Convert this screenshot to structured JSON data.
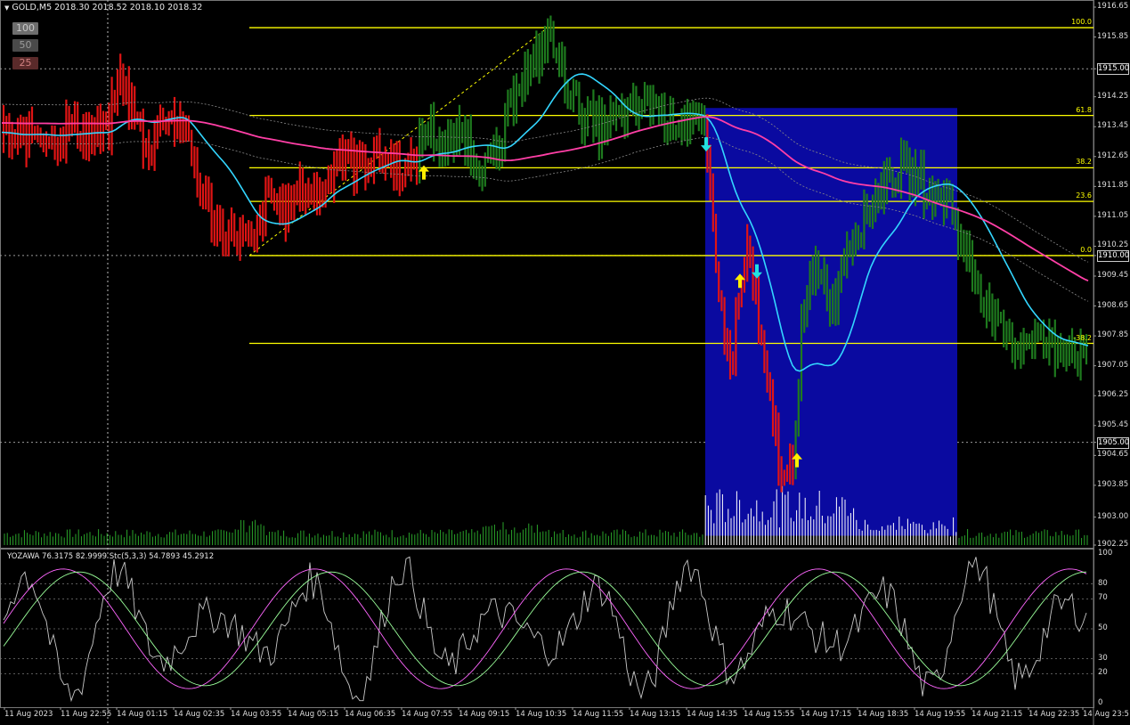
{
  "header": {
    "symbol_info": "GOLD,M5  2018.30 2018.52 2018.10 2018.32",
    "collapse_icon": "triangle-down-icon"
  },
  "level_buttons": [
    "100",
    "50",
    "25"
  ],
  "price_axis": {
    "ticks": [
      "1916.65",
      "1915.85",
      "1915.00",
      "1914.25",
      "1913.45",
      "1912.65",
      "1911.85",
      "1911.05",
      "1910.25",
      "1910.00",
      "1909.45",
      "1908.65",
      "1907.85",
      "1907.05",
      "1906.25",
      "1905.45",
      "1905.00",
      "1904.65",
      "1903.85",
      "1903.00",
      "1902.25"
    ],
    "highlighted": [
      "1915.00",
      "1910.00",
      "1905.00"
    ]
  },
  "fibo_labels": [
    "100.0",
    "61.8",
    "38.2",
    "23.6",
    "0.0",
    "-38.2"
  ],
  "time_axis": [
    "11 Aug 2023",
    "11 Aug 22:55",
    "14 Aug 01:15",
    "14 Aug 02:35",
    "14 Aug 03:55",
    "14 Aug 05:15",
    "14 Aug 06:35",
    "14 Aug 07:55",
    "14 Aug 09:15",
    "14 Aug 10:35",
    "14 Aug 11:55",
    "14 Aug 13:15",
    "14 Aug 14:35",
    "14 Aug 15:55",
    "14 Aug 17:15",
    "14 Aug 18:35",
    "14 Aug 19:55",
    "14 Aug 21:15",
    "14 Aug 22:35",
    "14 Aug 23:5"
  ],
  "oscillator": {
    "header": "YOZAWA 76.3175 82.9999  Stc(5,3,3) 54.7893 45.2912",
    "ticks": [
      "100",
      "80",
      "70",
      "50",
      "30",
      "20",
      "0"
    ]
  },
  "colors": {
    "background": "#000000",
    "bull_bar": "#1e7a1e",
    "bear_bar": "#e01414",
    "fibo": "#ffff00",
    "ma_fast": "#33d6ff",
    "ma_slow": "#ff3fa6",
    "box": "#0a0aa0",
    "osc_main": "#c8c8c8",
    "osc_signal": "#ff66ff",
    "osc_second": "#9aff9a"
  },
  "chart_data": {
    "type": "candlestick",
    "symbol": "GOLD",
    "timeframe": "M5",
    "ylim": [
      1902.25,
      1916.65
    ],
    "fibonacci": {
      "high": 1916.1,
      "low": 1910.0,
      "levels": [
        {
          "label": "100.0",
          "price": 1916.1
        },
        {
          "label": "61.8",
          "price": 1913.75
        },
        {
          "label": "38.2",
          "price": 1912.35
        },
        {
          "label": "23.6",
          "price": 1911.45
        },
        {
          "label": "0.0",
          "price": 1910.0
        },
        {
          "label": "-38.2",
          "price": 1907.65
        }
      ]
    },
    "price_path": [
      [
        0,
        1913.3
      ],
      [
        20,
        1913.0
      ],
      [
        40,
        1913.4
      ],
      [
        60,
        1913.1
      ],
      [
        80,
        1913.5
      ],
      [
        100,
        1913.2
      ],
      [
        120,
        1913.3
      ],
      [
        135,
        1914.8
      ],
      [
        150,
        1913.8
      ],
      [
        165,
        1912.8
      ],
      [
        185,
        1913.8
      ],
      [
        205,
        1913.5
      ],
      [
        225,
        1911.8
      ],
      [
        245,
        1910.7
      ],
      [
        265,
        1910.6
      ],
      [
        285,
        1910.2
      ],
      [
        300,
        1911.6
      ],
      [
        320,
        1911.2
      ],
      [
        340,
        1911.8
      ],
      [
        360,
        1911.6
      ],
      [
        380,
        1912.8
      ],
      [
        400,
        1912.4
      ],
      [
        420,
        1912.7
      ],
      [
        440,
        1912.5
      ],
      [
        460,
        1912.2
      ],
      [
        480,
        1913.5
      ],
      [
        500,
        1912.8
      ],
      [
        520,
        1913.3
      ],
      [
        540,
        1912.4
      ],
      [
        560,
        1912.6
      ],
      [
        580,
        1914.7
      ],
      [
        600,
        1915.0
      ],
      [
        615,
        1916.0
      ],
      [
        630,
        1915.0
      ],
      [
        650,
        1913.9
      ],
      [
        670,
        1913.4
      ],
      [
        690,
        1913.6
      ],
      [
        710,
        1913.8
      ],
      [
        730,
        1914.2
      ],
      [
        750,
        1913.6
      ],
      [
        770,
        1913.7
      ],
      [
        790,
        1913.3
      ],
      [
        800,
        1911.2
      ],
      [
        810,
        1908.4
      ],
      [
        820,
        1907.0
      ],
      [
        830,
        1908.8
      ],
      [
        840,
        1910.3
      ],
      [
        850,
        1908.4
      ],
      [
        860,
        1906.6
      ],
      [
        870,
        1905.3
      ],
      [
        880,
        1903.8
      ],
      [
        890,
        1904.5
      ],
      [
        900,
        1907.9
      ],
      [
        910,
        1909.2
      ],
      [
        920,
        1909.8
      ],
      [
        935,
        1908.6
      ],
      [
        950,
        1910.3
      ],
      [
        970,
        1911.0
      ],
      [
        990,
        1911.9
      ],
      [
        1010,
        1912.3
      ],
      [
        1030,
        1912.1
      ],
      [
        1050,
        1911.5
      ],
      [
        1065,
        1911.6
      ],
      [
        1080,
        1910.3
      ],
      [
        1100,
        1909.2
      ],
      [
        1120,
        1908.0
      ],
      [
        1140,
        1907.6
      ],
      [
        1160,
        1907.9
      ],
      [
        1180,
        1907.5
      ],
      [
        1200,
        1907.7
      ],
      [
        1220,
        1907.1
      ]
    ],
    "signals": [
      {
        "type": "buy",
        "price": 1912.2
      },
      {
        "type": "sell",
        "price": 1913.0
      },
      {
        "type": "buy",
        "price": 1909.3
      },
      {
        "type": "sell",
        "price": 1909.6
      },
      {
        "type": "buy",
        "price": 1904.5
      }
    ],
    "oscillator_levels": [
      100,
      80,
      70,
      50,
      30,
      20,
      0
    ]
  }
}
